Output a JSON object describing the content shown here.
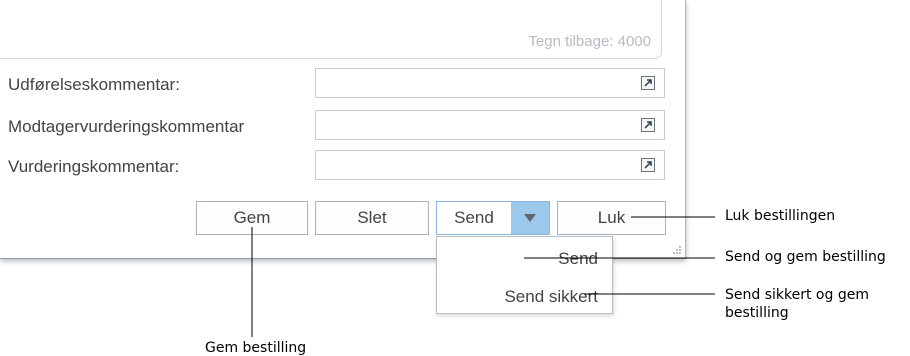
{
  "memo": {
    "chars_left": "Tegn tilbage: 4000"
  },
  "fields": [
    {
      "label": "Udførelseskommentar:",
      "value": ""
    },
    {
      "label": "Modtagervurderingskommentar",
      "value": ""
    },
    {
      "label": "Vurderingskommentar:",
      "value": ""
    }
  ],
  "buttons": {
    "gem": "Gem",
    "slet": "Slet",
    "send": "Send",
    "luk": "Luk"
  },
  "dropdown": {
    "items": [
      "Send",
      "Send sikkert"
    ]
  },
  "callouts": {
    "luk": "Luk bestillingen",
    "send": "Send og gem bestilling",
    "send_sikkert_line1": "Send sikkert og gem",
    "send_sikkert_line2": "bestilling",
    "gem": "Gem bestilling"
  },
  "colors": {
    "split_arrow": "#9cc8ec",
    "split_border": "#8ab8de",
    "text": "#404447"
  },
  "icons": {
    "expand": "expand-icon",
    "dropdown": "chevron-down-icon",
    "grip": "resize-grip-icon"
  }
}
